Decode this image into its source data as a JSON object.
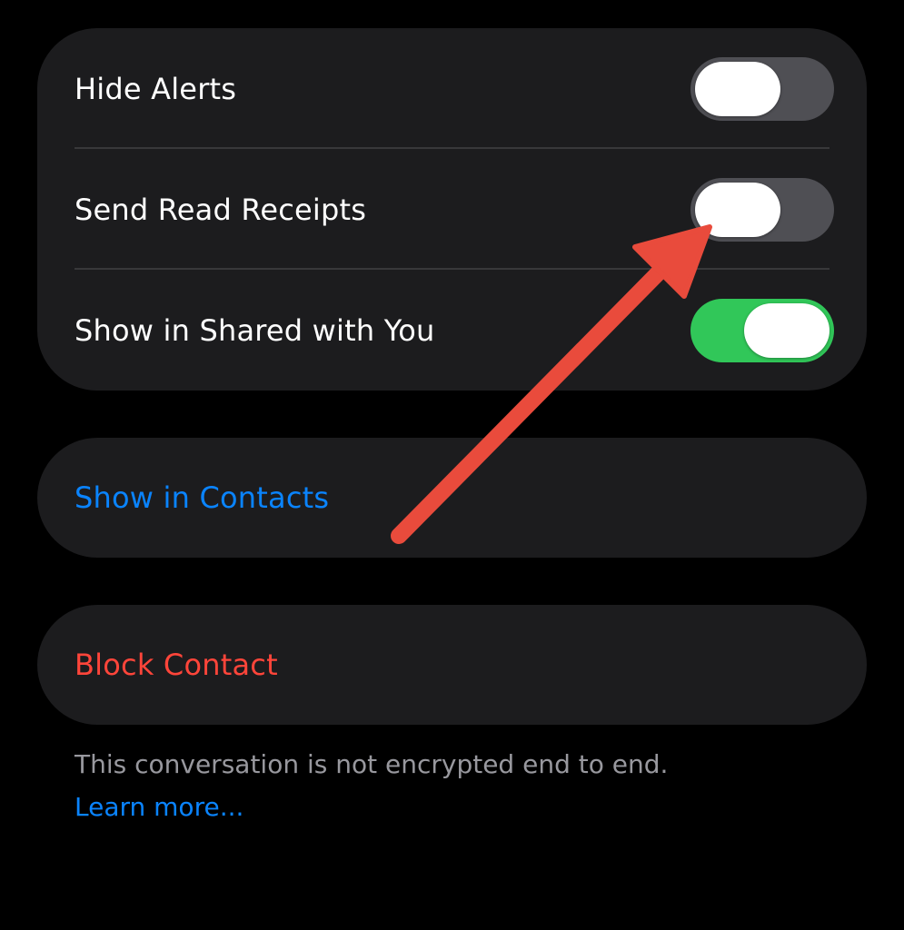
{
  "settings": {
    "rows": [
      {
        "label": "Hide Alerts",
        "toggle_on": false
      },
      {
        "label": "Send Read Receipts",
        "toggle_on": false
      },
      {
        "label": "Show in Shared with You",
        "toggle_on": true
      }
    ]
  },
  "actions": {
    "show_in_contacts": "Show in Contacts",
    "block_contact": "Block Contact"
  },
  "footer": {
    "note": "This conversation is not encrypted end to end.",
    "learn_more": "Learn more..."
  },
  "colors": {
    "background": "#000000",
    "group_background": "#1c1c1e",
    "toggle_off": "#4f4f54",
    "toggle_on": "#31c759",
    "link_blue": "#0a84ff",
    "destructive_red": "#ff453a",
    "annotation_arrow": "#e94b3c"
  }
}
